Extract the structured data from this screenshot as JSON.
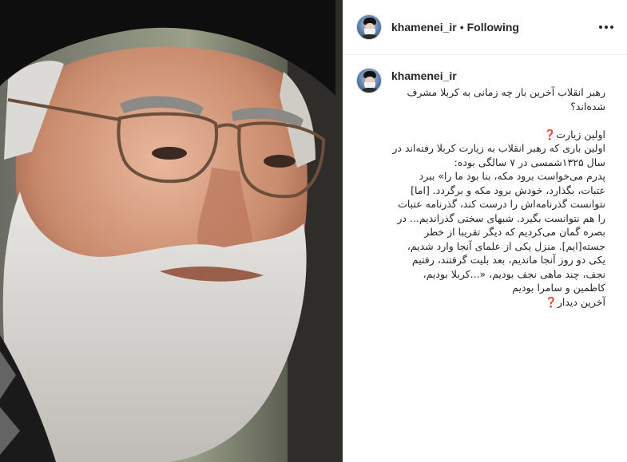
{
  "header": {
    "username": "khamenei_ir",
    "separator": "•",
    "follow_status": "Following"
  },
  "caption": {
    "username": "khamenei_ir",
    "lines": [
      "رهبر انقلاب آخرین بار چه زمانی به کربلا مشرف شده‌اند؟",
      "",
      "اولین زیارت❓",
      "اولین باری که رهبر انقلاب به زیارت کربلا رفته‌اند در سال ۱۳۲۵شمسی در ۷ سالگی بوده:",
      "پدرم می‌خواست برود مکه، بنا بود ما را» ببرد عتبات، بگذارد، خودش برود مکه و برگردد. [اما] نتوانست گذرنامه‌اش را درست کند، گذرنامه عتبات را هم نتوانست بگیرد. شبهای سختی گذراندیم... در بصره گمان می‌کردیم که دیگر تقریبا از خطر جسته[ایم]. منزل یکی از علمای آنجا وارد شدیم، یکی دو روز آنجا ماندیم، بعد بلیت گرفتند، رفتیم نجف، چند ماهی نجف بودیم، «...کربلا بودیم، کاظمین و سامرا بودیم",
      "آخرین دیدار❓"
    ]
  },
  "icons": {
    "avatar": "profile-avatar",
    "more": "more-options-icon"
  },
  "colors": {
    "text": "#262626",
    "border": "#efefef",
    "background": "#ffffff"
  }
}
